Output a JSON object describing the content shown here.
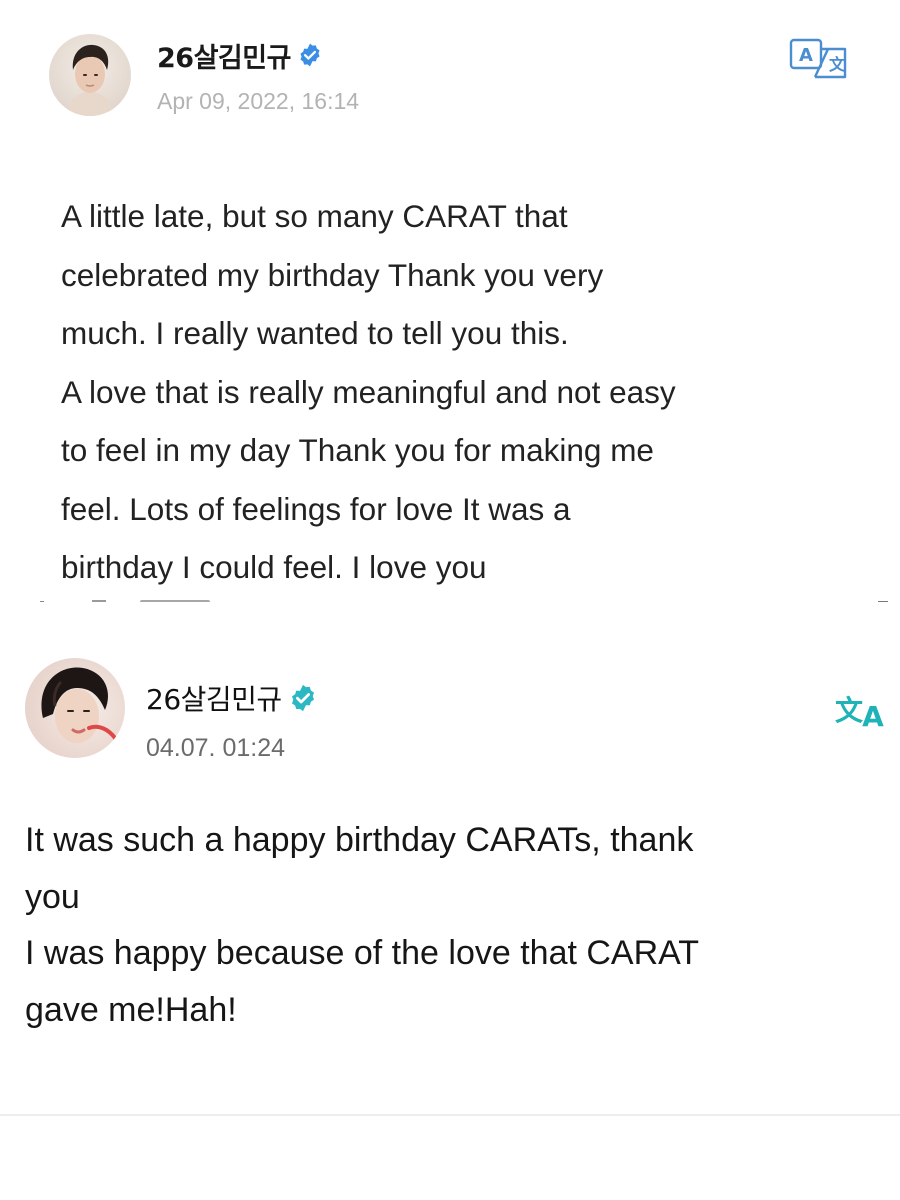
{
  "posts": [
    {
      "author": "26살김민규",
      "verified": true,
      "verified_color": "#3a8ee6",
      "timestamp": "Apr 09, 2022, 16:14",
      "translate_icon": "translate-a-to-wen-icon",
      "body": "A little late, but so many CARAT that\ncelebrated my birthday Thank you very\nmuch. I really wanted to tell you this.\nA love that is really meaningful and not easy\nto feel in my day Thank you for making me\nfeel. Lots of feelings for love It was a\nbirthday I could feel. I love you"
    },
    {
      "author": "26살김민규",
      "verified": true,
      "verified_color": "#2bb8c4",
      "timestamp": "04.07. 01:24",
      "translate_icon": "translate-wen-to-a-icon",
      "translate_color": "#1fb3b8",
      "body": "It was such a happy birthday CARATs, thank\nyou\nI was happy because of the love that CARAT\ngave me!Hah!"
    }
  ]
}
